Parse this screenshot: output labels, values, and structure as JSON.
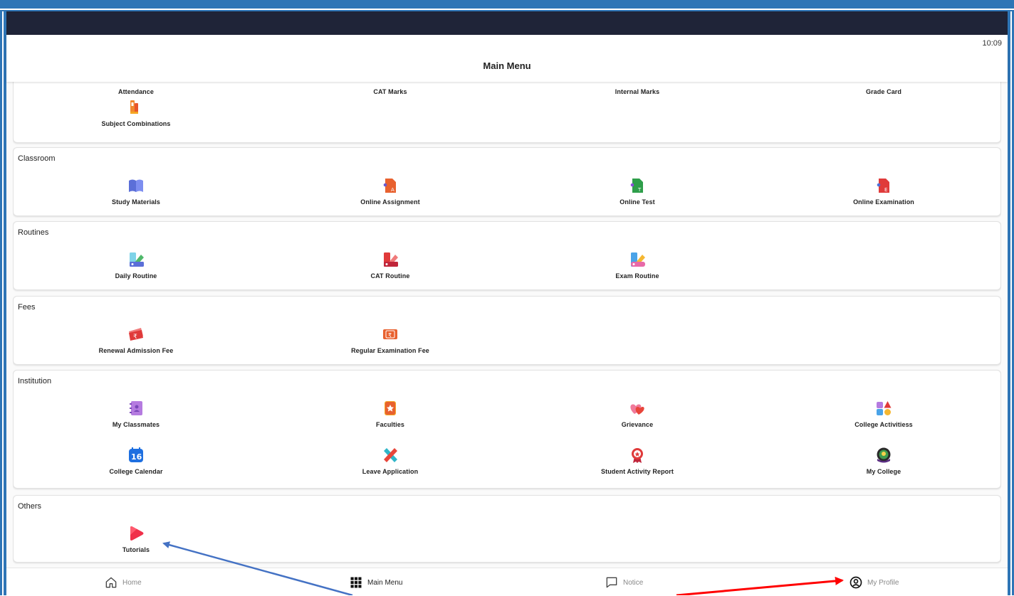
{
  "status": {
    "time": "10:09"
  },
  "header": {
    "title": "Main Menu"
  },
  "sections": {
    "academics": {
      "items": [
        {
          "label": "Attendance"
        },
        {
          "label": "CAT Marks"
        },
        {
          "label": "Internal Marks"
        },
        {
          "label": "Grade Card"
        },
        {
          "label": "Subject Combinations",
          "icon": "folders-icon"
        }
      ]
    },
    "classroom": {
      "title": "Classroom",
      "items": [
        {
          "label": "Study Materials",
          "icon": "book-icon"
        },
        {
          "label": "Online Assignment",
          "icon": "assignment-doc-icon"
        },
        {
          "label": "Online Test",
          "icon": "test-doc-icon"
        },
        {
          "label": "Online Examination",
          "icon": "exam-doc-icon"
        }
      ]
    },
    "routines": {
      "title": "Routines",
      "items": [
        {
          "label": "Daily Routine",
          "icon": "swatch-icon"
        },
        {
          "label": "CAT Routine",
          "icon": "swatch-red-icon"
        },
        {
          "label": "Exam Routine",
          "icon": "swatch-multi-icon"
        }
      ]
    },
    "fees": {
      "title": "Fees",
      "items": [
        {
          "label": "Renewal Admission Fee",
          "icon": "rupee-ticket-icon"
        },
        {
          "label": "Regular Examination Fee",
          "icon": "rupee-note-icon"
        }
      ]
    },
    "institution": {
      "title": "Institution",
      "items": [
        {
          "label": "My Classmates",
          "icon": "contacts-book-icon"
        },
        {
          "label": "Faculties",
          "icon": "star-badge-icon"
        },
        {
          "label": "Grievance",
          "icon": "hearts-icon"
        },
        {
          "label": "College Activitiess",
          "icon": "shapes-icon"
        },
        {
          "label": "College Calendar",
          "icon": "calendar-16-icon"
        },
        {
          "label": "Leave Application",
          "icon": "cross-icon"
        },
        {
          "label": "Student Activity Report",
          "icon": "award-icon"
        },
        {
          "label": "My College",
          "icon": "college-emblem-icon"
        }
      ]
    },
    "others": {
      "title": "Others",
      "items": [
        {
          "label": "Tutorials",
          "icon": "play-icon"
        }
      ]
    }
  },
  "bottom_nav": {
    "home": "Home",
    "main_menu": "Main Menu",
    "notice": "Notice",
    "my_profile": "My Profile"
  },
  "colors": {
    "frame": "#2e75b6",
    "top_bar": "#1f2438",
    "annotation_blue": "#4472c4",
    "annotation_red": "#ff0000"
  }
}
